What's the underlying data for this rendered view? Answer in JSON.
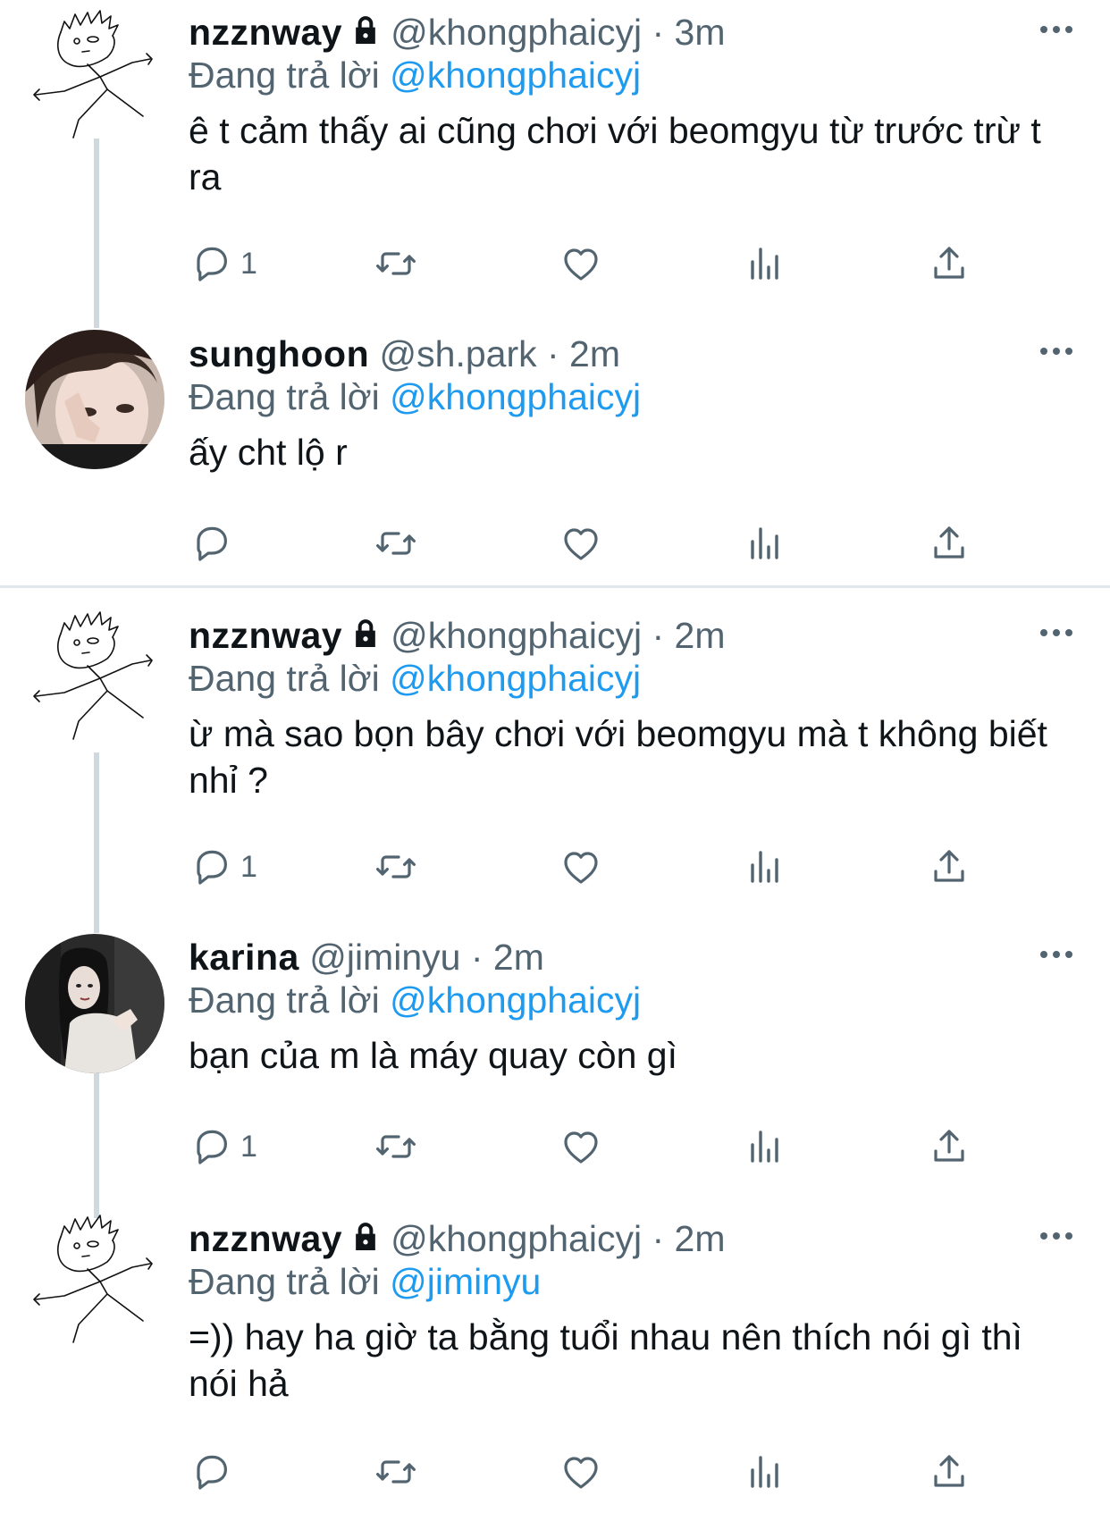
{
  "tweets": [
    {
      "name": "nzznway",
      "handle": "@khongphaicyj",
      "time": "· 3m",
      "locked": true,
      "reply_prefix": "Đang trả lời",
      "reply_to": "@khongphaicyj",
      "text": "ê t cảm thấy ai cũng chơi với beomgyu từ trước trừ t ra",
      "reply_count": "1"
    },
    {
      "name": "sunghoon",
      "handle": "@sh.park",
      "time": "· 2m",
      "locked": false,
      "reply_prefix": "Đang trả lời",
      "reply_to": "@khongphaicyj",
      "text": "ấy cht lộ r",
      "reply_count": ""
    },
    {
      "name": "nzznway",
      "handle": "@khongphaicyj",
      "time": "· 2m",
      "locked": true,
      "reply_prefix": "Đang trả lời",
      "reply_to": "@khongphaicyj",
      "text": "ừ mà sao bọn bây chơi với beomgyu mà t không biết nhỉ ?",
      "reply_count": "1"
    },
    {
      "name": "karina",
      "handle": "@jiminyu",
      "time": "· 2m",
      "locked": false,
      "reply_prefix": "Đang trả lời",
      "reply_to": "@khongphaicyj",
      "text": "bạn của m là máy quay còn gì",
      "reply_count": "1"
    },
    {
      "name": "nzznway",
      "handle": "@khongphaicyj",
      "time": "· 2m",
      "locked": true,
      "reply_prefix": "Đang trả lời",
      "reply_to": "@jiminyu",
      "text": "=)) hay ha giờ ta bằng tuổi nhau nên thích nói gì thì nói hả",
      "reply_count": ""
    }
  ],
  "icons": {
    "reply": "reply-icon",
    "retweet": "retweet-icon",
    "like": "heart-icon",
    "analytics": "analytics-icon",
    "share": "share-icon",
    "more": "more-icon",
    "lock": "lock-icon"
  },
  "colors": {
    "link": "#1d9bf0",
    "secondary": "#536471",
    "thread_line": "#cfd9de",
    "icon": "#536471"
  }
}
